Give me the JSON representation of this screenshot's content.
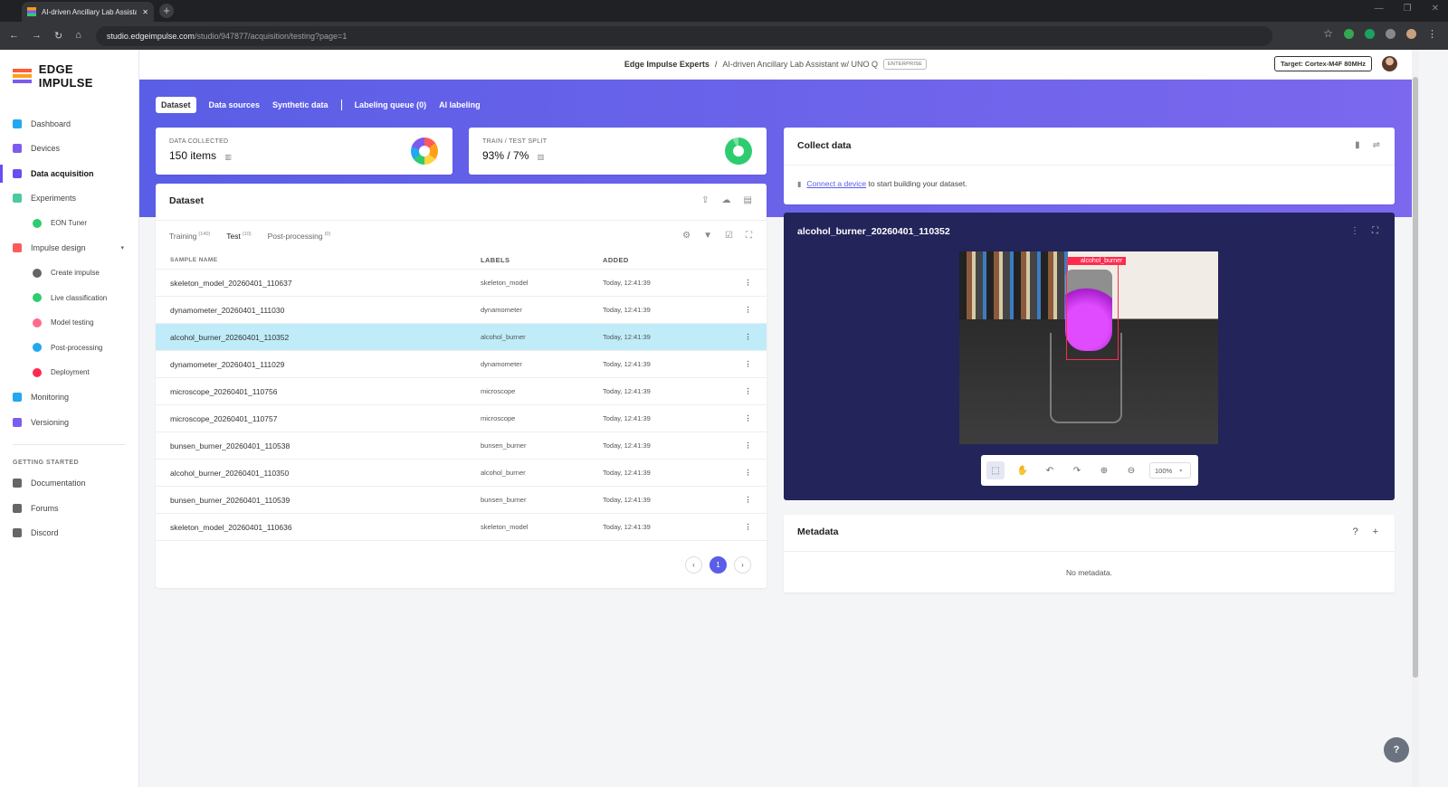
{
  "browser": {
    "tab_title": "AI-driven Ancillary Lab Assistan",
    "url_host": "studio.edgeimpulse.com",
    "url_path": "/studio/947877/acquisition/testing?page=1"
  },
  "sidebar": {
    "brand": "EDGE IMPULSE",
    "items": [
      {
        "label": "Dashboard",
        "color": "#22a7f0"
      },
      {
        "label": "Devices",
        "color": "#7e5bef"
      },
      {
        "label": "Data acquisition",
        "color": "#6c4cf1"
      },
      {
        "label": "Experiments",
        "color": "#4cc9a0"
      },
      {
        "label": "EON Tuner",
        "color": "#2ecc71"
      },
      {
        "label": "Impulse design",
        "color": "#ff5b5b"
      },
      {
        "label": "Create impulse",
        "color": "#666666"
      },
      {
        "label": "Live classification",
        "color": "#2ecc71"
      },
      {
        "label": "Model testing",
        "color": "#ff6b8b"
      },
      {
        "label": "Post-processing",
        "color": "#22a7f0"
      },
      {
        "label": "Deployment",
        "color": "#ff2b4f"
      },
      {
        "label": "Monitoring",
        "color": "#22a7f0"
      },
      {
        "label": "Versioning",
        "color": "#7e5bef"
      }
    ],
    "getting_started_heading": "GETTING STARTED",
    "links": [
      "Documentation",
      "Forums",
      "Discord"
    ]
  },
  "header": {
    "org": "Edge Impulse Experts",
    "separator": "/",
    "project": "AI-driven Ancillary Lab Assistant w/ UNO Q",
    "badge": "ENTERPRISE",
    "target": "Target: Cortex-M4F 80MHz"
  },
  "tabs": [
    "Dataset",
    "Data sources",
    "Synthetic data",
    "Labeling queue (0)",
    "AI labeling"
  ],
  "stats": {
    "collected_label": "DATA COLLECTED",
    "collected_value": "150 items",
    "split_label": "TRAIN / TEST SPLIT",
    "split_value": "93% / 7%"
  },
  "dataset": {
    "title": "Dataset",
    "subtabs": [
      {
        "label": "Training",
        "count": "(140)"
      },
      {
        "label": "Test",
        "count": "(10)"
      },
      {
        "label": "Post-processing",
        "count": "(0)"
      }
    ],
    "columns": [
      "SAMPLE NAME",
      "LABELS",
      "ADDED"
    ],
    "rows": [
      {
        "name": "skeleton_model_20260401_110637",
        "label": "skeleton_model",
        "added": "Today, 12:41:39"
      },
      {
        "name": "dynamometer_20260401_111030",
        "label": "dynamometer",
        "added": "Today, 12:41:39"
      },
      {
        "name": "alcohol_burner_20260401_110352",
        "label": "alcohol_burner",
        "added": "Today, 12:41:39"
      },
      {
        "name": "dynamometer_20260401_111029",
        "label": "dynamometer",
        "added": "Today, 12:41:39"
      },
      {
        "name": "microscope_20260401_110756",
        "label": "microscope",
        "added": "Today, 12:41:39"
      },
      {
        "name": "microscope_20260401_110757",
        "label": "microscope",
        "added": "Today, 12:41:39"
      },
      {
        "name": "bunsen_burner_20260401_110538",
        "label": "bunsen_burner",
        "added": "Today, 12:41:39"
      },
      {
        "name": "alcohol_burner_20260401_110350",
        "label": "alcohol_burner",
        "added": "Today, 12:41:39"
      },
      {
        "name": "bunsen_burner_20260401_110539",
        "label": "bunsen_burner",
        "added": "Today, 12:41:39"
      },
      {
        "name": "skeleton_model_20260401_110636",
        "label": "skeleton_model",
        "added": "Today, 12:41:39"
      }
    ],
    "selected_row": 2,
    "page": "1"
  },
  "collect": {
    "title": "Collect data",
    "link": "Connect a device",
    "text": " to start building your dataset."
  },
  "preview": {
    "title": "alcohol_burner_20260401_110352",
    "bbox_label": "alcohol_burner",
    "zoom": "100%"
  },
  "metadata": {
    "title": "Metadata",
    "empty": "No metadata."
  },
  "colors": {
    "accent": "#5a5ee6",
    "selected_row": "#bfecf8",
    "bbox": "#ff2b4f"
  }
}
